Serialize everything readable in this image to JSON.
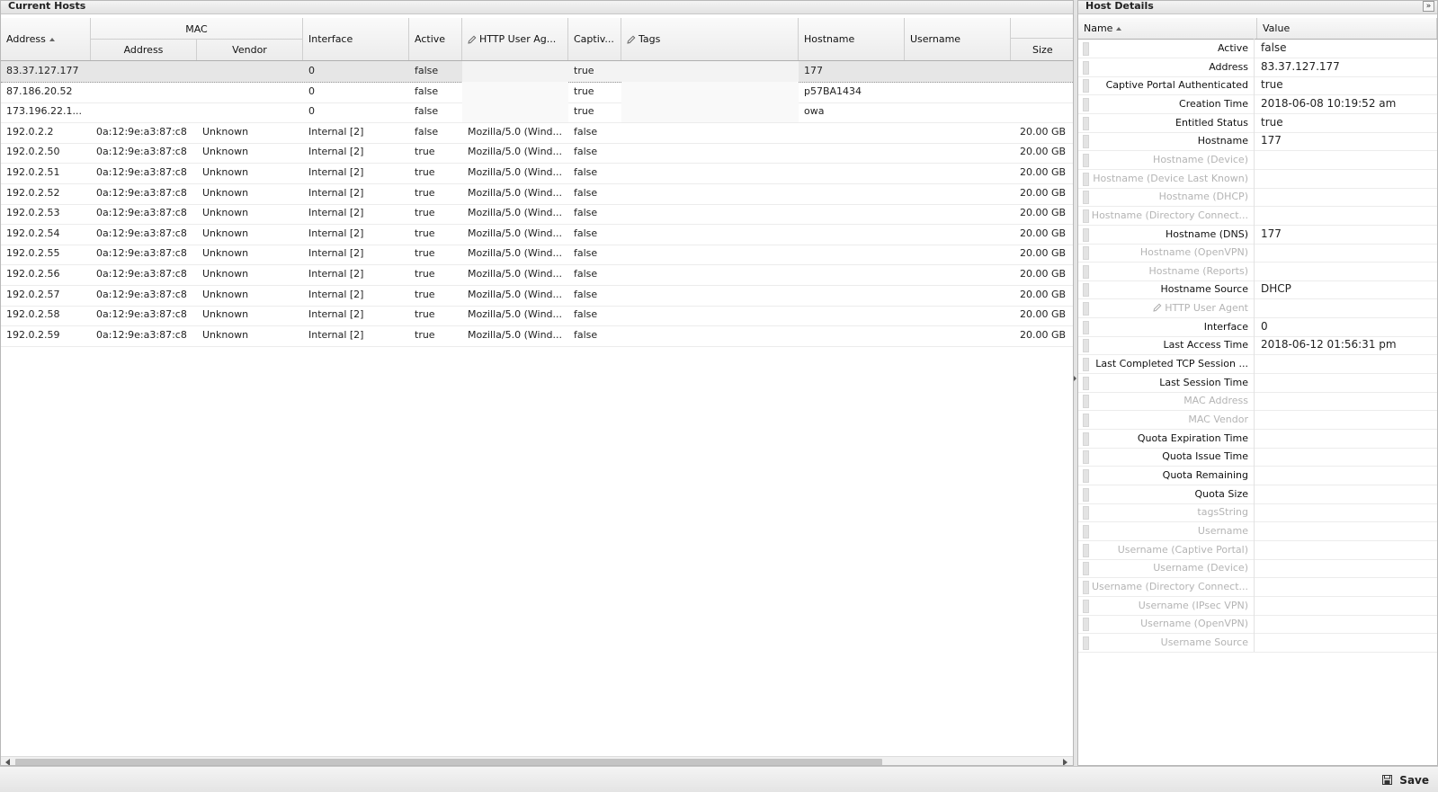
{
  "left_panel": {
    "title": "Current Hosts",
    "header": {
      "address": "Address",
      "mac_group": "MAC",
      "mac_address": "Address",
      "mac_vendor": "Vendor",
      "interface": "Interface",
      "active": "Active",
      "http_user_agent": "HTTP User Ag...",
      "captive": "Captiv...",
      "tags": "Tags",
      "hostname": "Hostname",
      "username": "Username",
      "size": "Size"
    },
    "rows": [
      {
        "address": "83.37.127.177",
        "mac": "",
        "vendor": "",
        "interface": "0",
        "active": "false",
        "agent": "",
        "captive": "true",
        "tags": "",
        "hostname": "177",
        "username": "",
        "size": ""
      },
      {
        "address": "87.186.20.52",
        "mac": "",
        "vendor": "",
        "interface": "0",
        "active": "false",
        "agent": "",
        "captive": "true",
        "tags": "",
        "hostname": "p57BA1434",
        "username": "",
        "size": ""
      },
      {
        "address": "173.196.22.1...",
        "mac": "",
        "vendor": "",
        "interface": "0",
        "active": "false",
        "agent": "",
        "captive": "true",
        "tags": "",
        "hostname": "owa",
        "username": "",
        "size": ""
      },
      {
        "address": "192.0.2.2",
        "mac": "0a:12:9e:a3:87:c8",
        "vendor": "Unknown",
        "interface": "Internal [2]",
        "active": "false",
        "agent": "Mozilla/5.0 (Wind...",
        "captive": "false",
        "tags": "",
        "hostname": "",
        "username": "",
        "size": "20.00 GB"
      },
      {
        "address": "192.0.2.50",
        "mac": "0a:12:9e:a3:87:c8",
        "vendor": "Unknown",
        "interface": "Internal [2]",
        "active": "true",
        "agent": "Mozilla/5.0 (Wind...",
        "captive": "false",
        "tags": "",
        "hostname": "",
        "username": "",
        "size": "20.00 GB"
      },
      {
        "address": "192.0.2.51",
        "mac": "0a:12:9e:a3:87:c8",
        "vendor": "Unknown",
        "interface": "Internal [2]",
        "active": "true",
        "agent": "Mozilla/5.0 (Wind...",
        "captive": "false",
        "tags": "",
        "hostname": "",
        "username": "",
        "size": "20.00 GB"
      },
      {
        "address": "192.0.2.52",
        "mac": "0a:12:9e:a3:87:c8",
        "vendor": "Unknown",
        "interface": "Internal [2]",
        "active": "true",
        "agent": "Mozilla/5.0 (Wind...",
        "captive": "false",
        "tags": "",
        "hostname": "",
        "username": "",
        "size": "20.00 GB"
      },
      {
        "address": "192.0.2.53",
        "mac": "0a:12:9e:a3:87:c8",
        "vendor": "Unknown",
        "interface": "Internal [2]",
        "active": "true",
        "agent": "Mozilla/5.0 (Wind...",
        "captive": "false",
        "tags": "",
        "hostname": "",
        "username": "",
        "size": "20.00 GB"
      },
      {
        "address": "192.0.2.54",
        "mac": "0a:12:9e:a3:87:c8",
        "vendor": "Unknown",
        "interface": "Internal [2]",
        "active": "true",
        "agent": "Mozilla/5.0 (Wind...",
        "captive": "false",
        "tags": "",
        "hostname": "",
        "username": "",
        "size": "20.00 GB"
      },
      {
        "address": "192.0.2.55",
        "mac": "0a:12:9e:a3:87:c8",
        "vendor": "Unknown",
        "interface": "Internal [2]",
        "active": "true",
        "agent": "Mozilla/5.0 (Wind...",
        "captive": "false",
        "tags": "",
        "hostname": "",
        "username": "",
        "size": "20.00 GB"
      },
      {
        "address": "192.0.2.56",
        "mac": "0a:12:9e:a3:87:c8",
        "vendor": "Unknown",
        "interface": "Internal [2]",
        "active": "true",
        "agent": "Mozilla/5.0 (Wind...",
        "captive": "false",
        "tags": "",
        "hostname": "",
        "username": "",
        "size": "20.00 GB"
      },
      {
        "address": "192.0.2.57",
        "mac": "0a:12:9e:a3:87:c8",
        "vendor": "Unknown",
        "interface": "Internal [2]",
        "active": "true",
        "agent": "Mozilla/5.0 (Wind...",
        "captive": "false",
        "tags": "",
        "hostname": "",
        "username": "",
        "size": "20.00 GB"
      },
      {
        "address": "192.0.2.58",
        "mac": "0a:12:9e:a3:87:c8",
        "vendor": "Unknown",
        "interface": "Internal [2]",
        "active": "true",
        "agent": "Mozilla/5.0 (Wind...",
        "captive": "false",
        "tags": "",
        "hostname": "",
        "username": "",
        "size": "20.00 GB"
      },
      {
        "address": "192.0.2.59",
        "mac": "0a:12:9e:a3:87:c8",
        "vendor": "Unknown",
        "interface": "Internal [2]",
        "active": "true",
        "agent": "Mozilla/5.0 (Wind...",
        "captive": "false",
        "tags": "",
        "hostname": "",
        "username": "",
        "size": "20.00 GB"
      }
    ]
  },
  "right_panel": {
    "title": "Host Details",
    "collapse_icon": "»",
    "header": {
      "name": "Name",
      "value": "Value"
    },
    "properties": [
      {
        "name": "Active",
        "value": "false",
        "dim": false
      },
      {
        "name": "Address",
        "value": "83.37.127.177",
        "dim": false
      },
      {
        "name": "Captive Portal Authenticated",
        "value": "true",
        "dim": false
      },
      {
        "name": "Creation Time",
        "value": "2018-06-08 10:19:52 am",
        "dim": false
      },
      {
        "name": "Entitled Status",
        "value": "true",
        "dim": false
      },
      {
        "name": "Hostname",
        "value": "177",
        "dim": false
      },
      {
        "name": "Hostname (Device)",
        "value": "",
        "dim": true
      },
      {
        "name": "Hostname (Device Last Known)",
        "value": "",
        "dim": true
      },
      {
        "name": "Hostname (DHCP)",
        "value": "",
        "dim": true
      },
      {
        "name": "Hostname (Directory Connect...",
        "value": "",
        "dim": true
      },
      {
        "name": "Hostname (DNS)",
        "value": "177",
        "dim": false
      },
      {
        "name": "Hostname (OpenVPN)",
        "value": "",
        "dim": true
      },
      {
        "name": "Hostname (Reports)",
        "value": "",
        "dim": true
      },
      {
        "name": "Hostname Source",
        "value": "DHCP",
        "dim": false
      },
      {
        "name": "HTTP User Agent",
        "value": "",
        "dim": true,
        "pencil": true
      },
      {
        "name": "Interface",
        "value": "0",
        "dim": false
      },
      {
        "name": "Last Access Time",
        "value": "2018-06-12 01:56:31 pm",
        "dim": false
      },
      {
        "name": "Last Completed TCP Session ...",
        "value": "",
        "dim": false
      },
      {
        "name": "Last Session Time",
        "value": "",
        "dim": false
      },
      {
        "name": "MAC Address",
        "value": "",
        "dim": true
      },
      {
        "name": "MAC Vendor",
        "value": "",
        "dim": true
      },
      {
        "name": "Quota Expiration Time",
        "value": "",
        "dim": false
      },
      {
        "name": "Quota Issue Time",
        "value": "",
        "dim": false
      },
      {
        "name": "Quota Remaining",
        "value": "",
        "dim": false
      },
      {
        "name": "Quota Size",
        "value": "",
        "dim": false
      },
      {
        "name": "tagsString",
        "value": "",
        "dim": true
      },
      {
        "name": "Username",
        "value": "",
        "dim": true
      },
      {
        "name": "Username (Captive Portal)",
        "value": "",
        "dim": true
      },
      {
        "name": "Username (Device)",
        "value": "",
        "dim": true
      },
      {
        "name": "Username (Directory Connect...",
        "value": "",
        "dim": true
      },
      {
        "name": "Username (IPsec VPN)",
        "value": "",
        "dim": true
      },
      {
        "name": "Username (OpenVPN)",
        "value": "",
        "dim": true
      },
      {
        "name": "Username Source",
        "value": "",
        "dim": true
      }
    ]
  },
  "toolbar": {
    "save_label": "Save",
    "save_icon": "floppy-disk-icon"
  },
  "colors": {
    "dim_text": "#b4b4b4",
    "selected_row": "#e6e6e6",
    "header_bg": "#ececec"
  }
}
